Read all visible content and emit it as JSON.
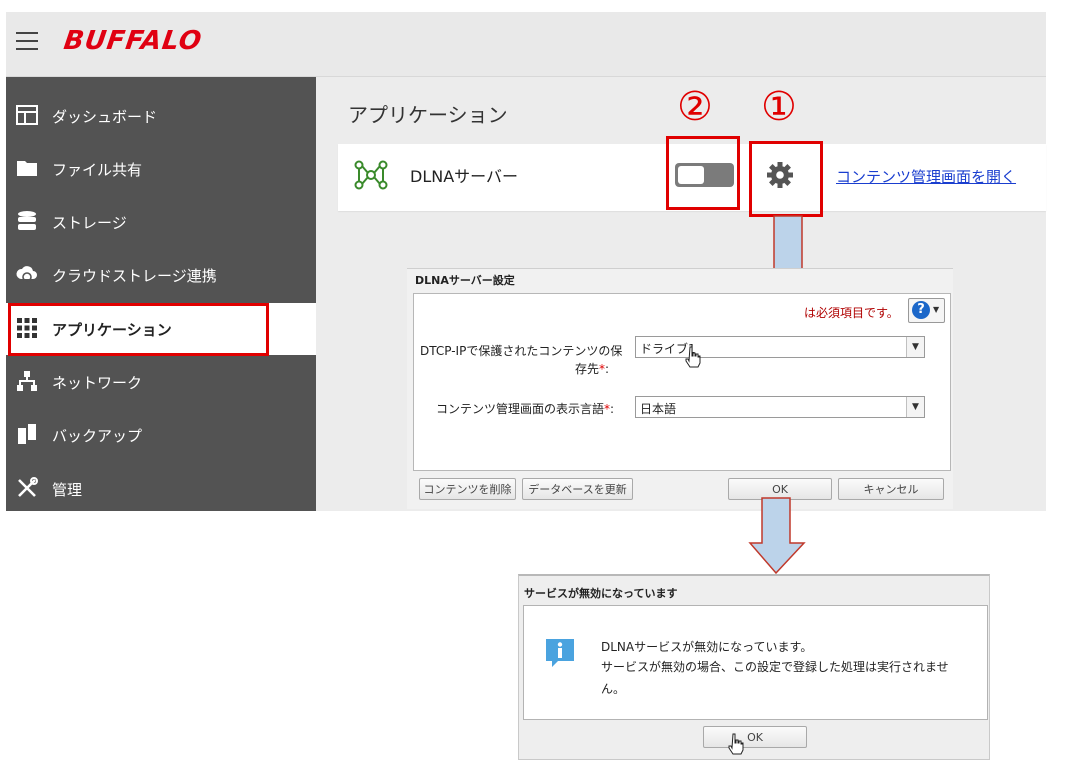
{
  "header": {
    "logo": "BUFFALO"
  },
  "sidebar": {
    "items": [
      {
        "label": "ダッシュボード",
        "icon": "dashboard-icon"
      },
      {
        "label": "ファイル共有",
        "icon": "folder-icon"
      },
      {
        "label": "ストレージ",
        "icon": "database-icon"
      },
      {
        "label": "クラウドストレージ連携",
        "icon": "cloud-sync-icon"
      },
      {
        "label": "アプリケーション",
        "icon": "apps-grid-icon",
        "active": true
      },
      {
        "label": "ネットワーク",
        "icon": "network-icon"
      },
      {
        "label": "バックアップ",
        "icon": "backup-icon"
      },
      {
        "label": "管理",
        "icon": "tools-icon"
      }
    ]
  },
  "main": {
    "title": "アプリケーション",
    "app": {
      "name": "DLNAサーバー",
      "enabled": false,
      "link": "コンテンツ管理画面を開く"
    }
  },
  "annotations": {
    "n1": "①",
    "n2": "②",
    "color": "#e00000"
  },
  "settings_dialog": {
    "title": "DLNAサーバー設定",
    "required_note": "は必須項目です。",
    "field1": {
      "label_line1": "DTCP-IPで保護されたコンテンツの保",
      "label_line2": "存先",
      "value": "ドライブ1"
    },
    "field2": {
      "label": "コンテンツ管理画面の表示言語",
      "value": "日本語"
    },
    "required_mark": "*",
    "colon": ":",
    "buttons": {
      "delete": "コンテンツを削除",
      "update": "データベースを更新",
      "ok": "OK",
      "cancel": "キャンセル"
    }
  },
  "service_dialog": {
    "title": "サービスが無効になっています",
    "message_line1": "DLNAサービスが無効になっています。",
    "message_line2": "サービスが無効の場合、この設定で登録した処理は実行されませ",
    "message_line3": "ん。",
    "ok": "OK"
  },
  "colors": {
    "brand": "#e00012",
    "sidebar_bg": "#535353",
    "link": "#1a3ecf",
    "arrow_fill": "#bcd3ea",
    "arrow_stroke": "#c0392b"
  }
}
